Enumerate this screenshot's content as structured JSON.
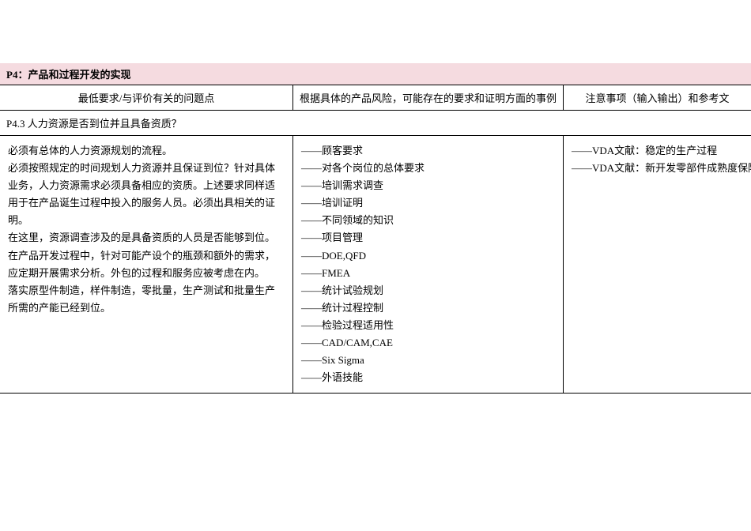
{
  "title": "P4：产品和过程开发的实现",
  "headers": {
    "col1": "最低要求/与评价有关的问题点",
    "col2": "根据具体的产品风险，可能存在的要求和证明方面的事例",
    "col3": "注意事项（输入输出）和参考文"
  },
  "question": "P4.3 人力资源是否到位并且具备资质？",
  "body": {
    "lines": [
      "必须有总体的人力资源规划的流程。",
      "必须按照规定的时间规划人力资源并且保证到位？针对具体业务，人力资源需求必须具备相应的资质。上述要求同样适用于在产品诞生过程中投入的服务人员。必须出具相关的证明。",
      "在这里，资源调查涉及的是具备资质的人员是否能够到位。",
      "在产品开发过程中，针对可能产设个的瓶颈和额外的需求，应定期开展需求分析。外包的过程和服务应被考虑在内。",
      "落实原型件制造，样件制造，零批量，生产测试和批量生产所需的产能已经到位。"
    ]
  },
  "examples": [
    "顾客要求",
    "对各个岗位的总体要求",
    "培训需求调查",
    "培训证明",
    "不同领域的知识",
    "项目管理",
    "DOE,QFD",
    "FMEA",
    "统计试验规划",
    "统计过程控制",
    "检验过程适用性",
    "CAD/CAM,CAE",
    "Six Sigma",
    "外语技能"
  ],
  "references": [
    "VDA文献：稳定的生产过程",
    "VDA文献：新开发零部件成熟度保障"
  ],
  "dash": "——"
}
